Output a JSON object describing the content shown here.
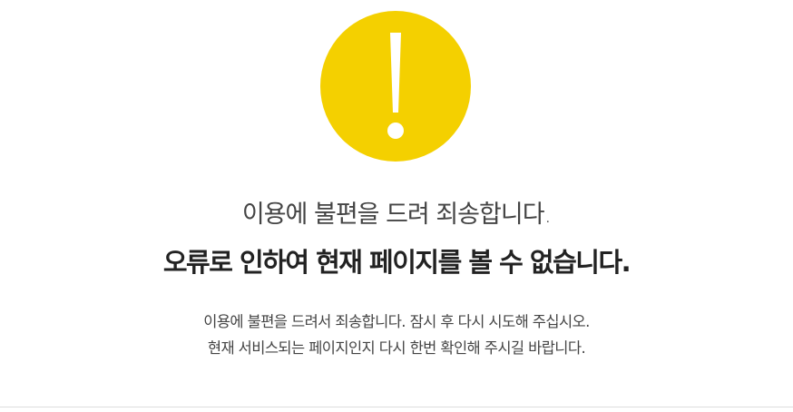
{
  "error": {
    "icon": "exclamation-icon",
    "icon_color": "#f4d000",
    "headline_1": "이용에 불편을 드려 죄송합니다.",
    "headline_2": "오류로 인하여 현재 페이지를 볼 수 없습니다.",
    "description_1": "이용에 불편을 드려서 죄송합니다. 잠시 후 다시 시도해 주십시오.",
    "description_2": "현재 서비스되는 페이지인지 다시 한번 확인해 주시길 바랍니다."
  }
}
